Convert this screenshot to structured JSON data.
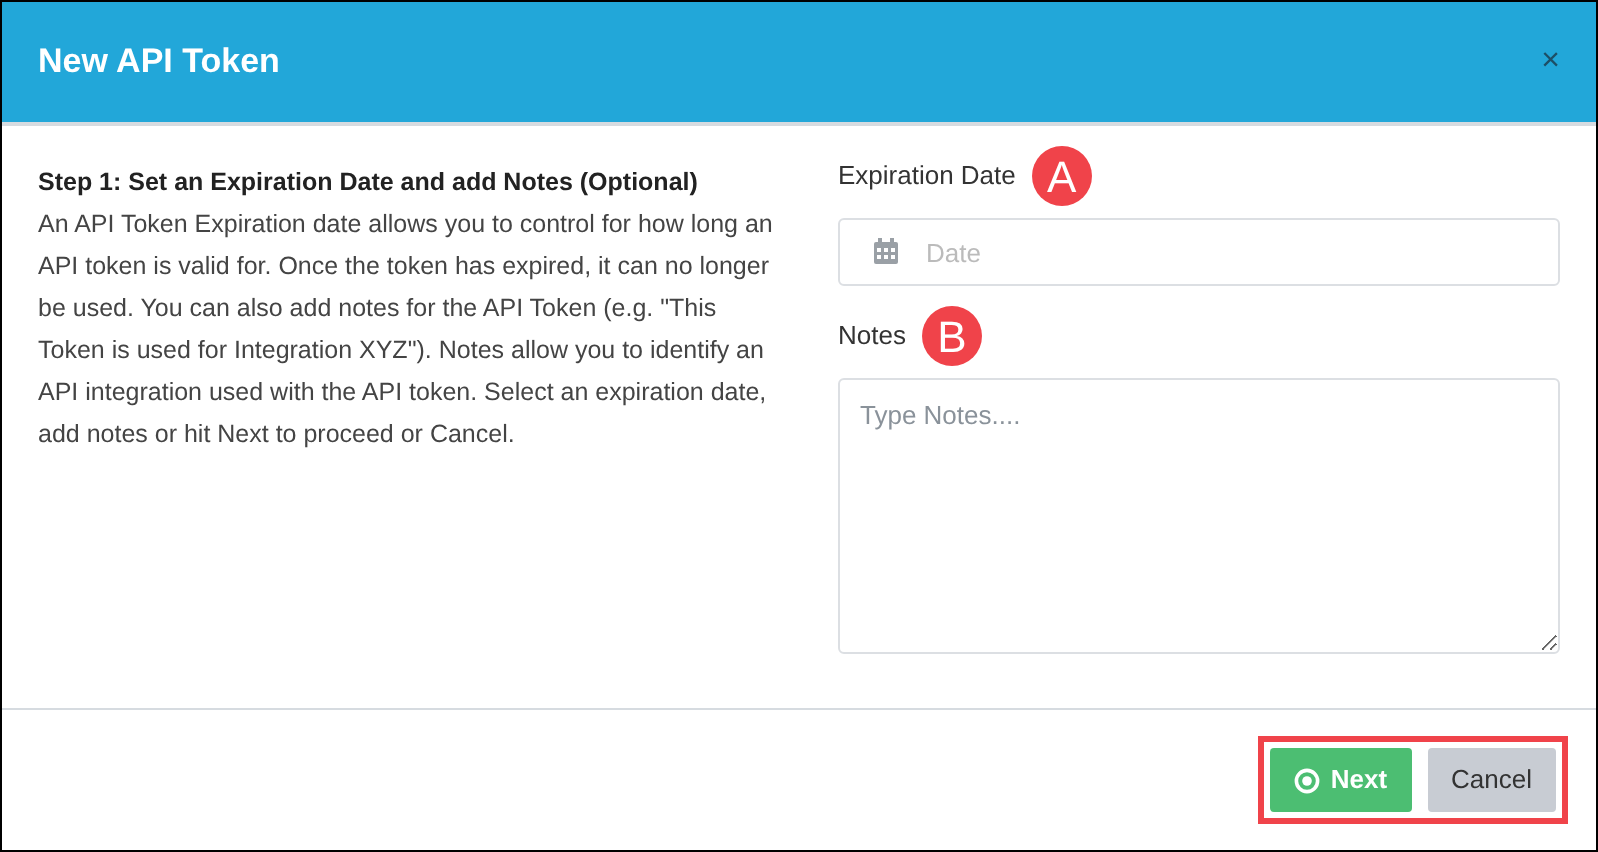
{
  "dialog": {
    "title": "New API Token",
    "close": "×"
  },
  "step": {
    "heading": "Step 1: Set an Expiration Date and add Notes (Optional)",
    "description": "An API Token Expiration date allows you to control for how long an API token is valid for. Once the token has expired, it can no longer be used. You can also add notes for the API Token (e.g. \"This Token is used for Integration XYZ\"). Notes allow you to identify an API integration used with the API token. Select an expiration date, add notes or hit Next to proceed or Cancel."
  },
  "fields": [
    {
      "kind": "date",
      "label": "Expiration Date",
      "marker": "A",
      "placeholder": "Date"
    },
    {
      "kind": "textarea",
      "label": "Notes",
      "marker": "B",
      "placeholder": "Type Notes...."
    }
  ],
  "buttons": [
    {
      "kind": "primary",
      "label": "Next"
    },
    {
      "kind": "secondary",
      "label": "Cancel"
    }
  ],
  "buttons_highlighted": true
}
